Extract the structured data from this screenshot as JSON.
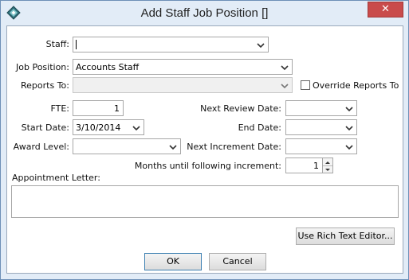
{
  "window": {
    "title": "Add Staff Job Position []",
    "close_label": "✕"
  },
  "form": {
    "staff": {
      "label": "Staff:",
      "value": ""
    },
    "job_position": {
      "label": "Job Position:",
      "value": "Accounts Staff"
    },
    "reports_to": {
      "label": "Reports To:",
      "value": ""
    },
    "override_reports_to": {
      "label": "Override Reports To",
      "checked": false
    },
    "fte": {
      "label": "FTE:",
      "value": "1"
    },
    "start_date": {
      "label": "Start Date:",
      "value": "3/10/2014"
    },
    "award_level": {
      "label": "Award Level:",
      "value": ""
    },
    "next_review_date": {
      "label": "Next Review Date:",
      "value": ""
    },
    "end_date": {
      "label": "End Date:",
      "value": ""
    },
    "next_increment_date": {
      "label": "Next Increment Date:",
      "value": ""
    },
    "months_until_increment": {
      "label": "Months until following increment:",
      "value": "1"
    },
    "appointment_letter": {
      "label": "Appointment Letter:",
      "value": ""
    }
  },
  "buttons": {
    "rich_text": "Use Rich Text Editor...",
    "ok": "OK",
    "cancel": "Cancel"
  },
  "icons": {
    "app": "app-diamond-icon",
    "dropdown": "chevron-down-icon",
    "spin_up": "spin-up-icon",
    "spin_down": "spin-down-icon"
  }
}
